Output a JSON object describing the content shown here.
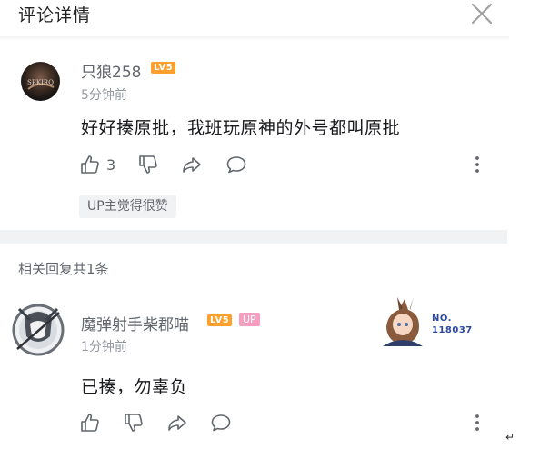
{
  "header": {
    "title": "评论详情"
  },
  "comment": {
    "username": "只狼258",
    "level": "LV5",
    "time": "5分钟前",
    "text": "好好揍原批，我班玩原神的外号都叫原批",
    "likes": "3",
    "up_liked_label": "UP主觉得很赞"
  },
  "replies_header": "相关回复共1条",
  "reply": {
    "username": "魔弹射手柴郡喵",
    "level": "LV5",
    "up_badge": "UP",
    "time": "1分钟前",
    "text": "已揍，勿辜负",
    "badge_card": {
      "line1": "NO.",
      "line2": "118037"
    }
  },
  "return_symbol": "↵",
  "colors": {
    "level_badge": "#ff9f2d",
    "up_badge": "#f69ec0",
    "divider": "#f1f2f3"
  }
}
